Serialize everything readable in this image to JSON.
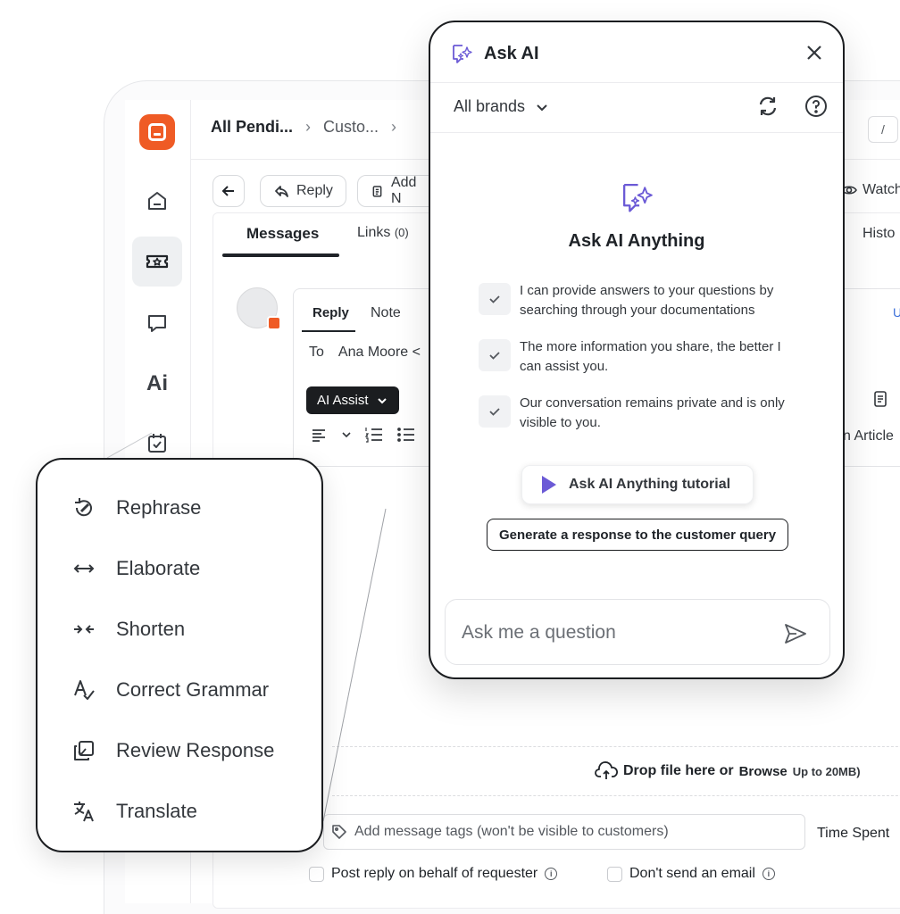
{
  "breadcrumb": {
    "item1": "All Pendi...",
    "item2": "Custo..."
  },
  "shortcut_key": "/",
  "toolbar": {
    "reply": "Reply",
    "add_note": "Add N",
    "watch": "Watch"
  },
  "tabs": {
    "messages": "Messages",
    "links": "Links",
    "links_count": "(0)",
    "history": "Histo"
  },
  "composer": {
    "reply_tab": "Reply",
    "note_tab": "Note",
    "to_label": "To",
    "to_value": "Ana Moore <",
    "ai_assist": "AI Assist",
    "article_label": "n Article",
    "link_char": "U"
  },
  "sidebar": {
    "ai_label": "Ai"
  },
  "ask_ai": {
    "title": "Ask AI",
    "brand_filter": "All brands",
    "heading": "Ask AI Anything",
    "features": [
      "I can provide answers to your questions by searching through your documentations",
      "The more information you share, the better I can assist you.",
      "Our conversation remains private and is only visible to you."
    ],
    "tutorial_button": "Ask AI Anything tutorial",
    "generate_button": "Generate a response to the customer query",
    "input_placeholder": "Ask me a question"
  },
  "ai_menu": {
    "items": [
      "Rephrase",
      "Elaborate",
      "Shorten",
      "Correct Grammar",
      "Review Response",
      "Translate"
    ]
  },
  "footer": {
    "drop_text": "Drop file here or",
    "browse": "Browse",
    "size_limit": "Up to 20MB)",
    "tags_placeholder": "Add message tags (won't be visible to customers)",
    "time_spent": "Time Spent",
    "post_on_behalf": "Post reply on behalf of requester",
    "dont_send_email": "Don't send an email"
  },
  "colors": {
    "brand": "#ef5b25",
    "ai_accent": "#6b5ad6",
    "dark": "#1b1d20"
  }
}
